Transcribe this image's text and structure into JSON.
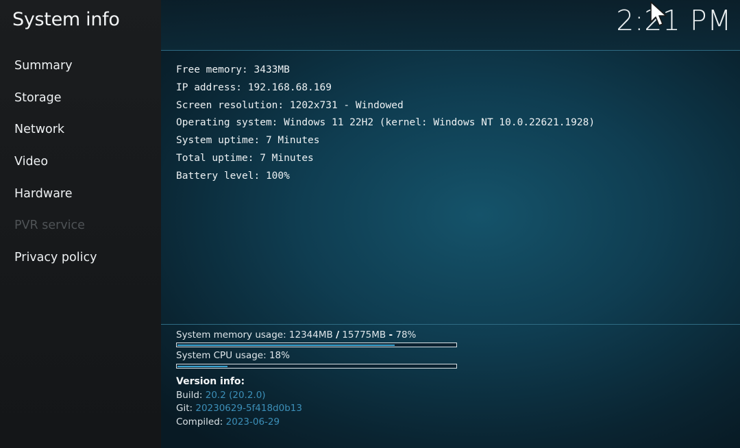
{
  "app": {
    "title": "System info",
    "clock": "2:21 PM"
  },
  "sidebar": {
    "items": [
      {
        "label": "Summary",
        "enabled": true
      },
      {
        "label": "Storage",
        "enabled": true
      },
      {
        "label": "Network",
        "enabled": true
      },
      {
        "label": "Video",
        "enabled": true
      },
      {
        "label": "Hardware",
        "enabled": true
      },
      {
        "label": "PVR service",
        "enabled": false
      },
      {
        "label": "Privacy policy",
        "enabled": true
      }
    ]
  },
  "summary": {
    "lines": [
      "Free memory: 3433MB",
      "IP address: 192.168.68.169",
      "Screen resolution: 1202x731 - Windowed",
      "Operating system: Windows 11 22H2 (kernel: Windows NT 10.0.22621.1928)",
      "System uptime: 7 Minutes",
      "Total uptime: 7 Minutes",
      "Battery level: 100%"
    ]
  },
  "usage": {
    "memory": {
      "label": "System memory usage: 12344MB",
      "sep": "/",
      "total": "15775MB",
      "dash": "-",
      "percent_text": "78%",
      "fraction": 0.78
    },
    "cpu": {
      "label": "System CPU usage: 18%",
      "fraction": 0.18
    }
  },
  "version": {
    "title": "Version info:",
    "build_label": "Build:",
    "build_value": "20.2 (20.2.0)",
    "git_label": "Git:",
    "git_value": "20230629-5f418d0b13",
    "compiled_label": "Compiled:",
    "compiled_value": "2023-06-29"
  },
  "colors": {
    "accent": "#3aa6d4",
    "link_value": "#3c8fb8",
    "disabled": "#4f5356"
  },
  "icons": {
    "cursor": "mouse-pointer-icon"
  }
}
